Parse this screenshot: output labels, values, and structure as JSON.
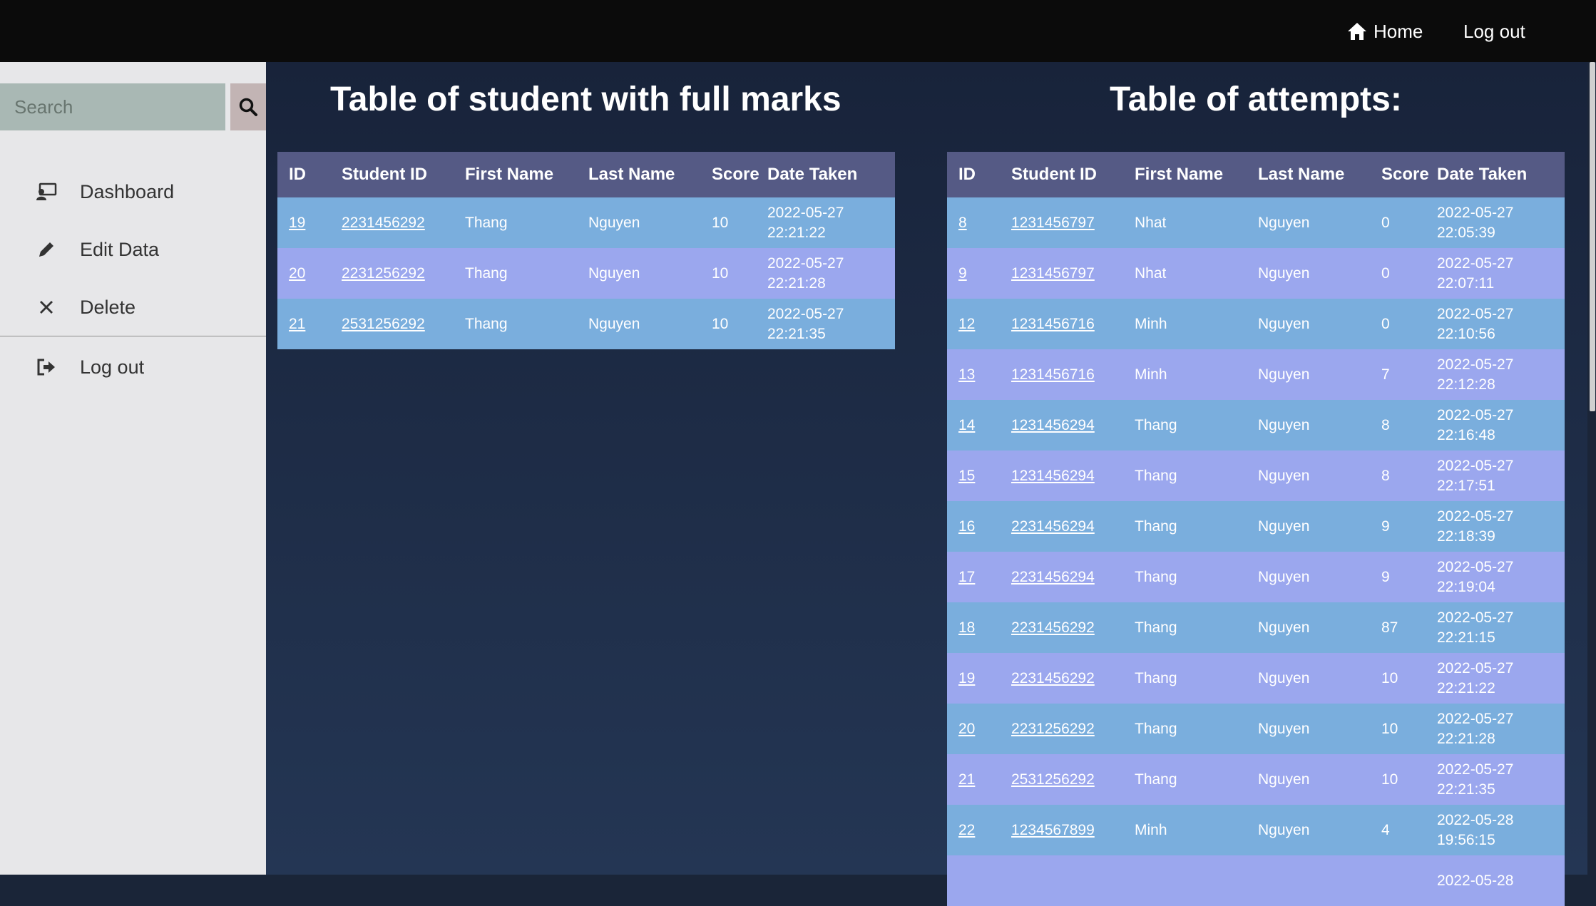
{
  "topbar": {
    "home_label": "Home",
    "logout_label": "Log out"
  },
  "sidebar": {
    "search_placeholder": "Search",
    "items": [
      {
        "label": "Dashboard",
        "icon": "dashboard-icon"
      },
      {
        "label": "Edit Data",
        "icon": "pencil-icon"
      },
      {
        "label": "Delete",
        "icon": "close-icon"
      },
      {
        "label": "Log out",
        "icon": "logout-icon"
      }
    ]
  },
  "columns": [
    "ID",
    "Student ID",
    "First Name",
    "Last Name",
    "Score",
    "Date Taken"
  ],
  "full_marks": {
    "title": "Table of student with full marks",
    "rows": [
      {
        "id": "19",
        "student_id": "2231456292",
        "first": "Thang",
        "last": "Nguyen",
        "score": "10",
        "date": "2022-05-27",
        "time": "22:21:22"
      },
      {
        "id": "20",
        "student_id": "2231256292",
        "first": "Thang",
        "last": "Nguyen",
        "score": "10",
        "date": "2022-05-27",
        "time": "22:21:28"
      },
      {
        "id": "21",
        "student_id": "2531256292",
        "first": "Thang",
        "last": "Nguyen",
        "score": "10",
        "date": "2022-05-27",
        "time": "22:21:35"
      }
    ]
  },
  "attempts": {
    "title": "Table of attempts:",
    "rows": [
      {
        "id": "8",
        "student_id": "1231456797",
        "first": "Nhat",
        "last": "Nguyen",
        "score": "0",
        "date": "2022-05-27",
        "time": "22:05:39"
      },
      {
        "id": "9",
        "student_id": "1231456797",
        "first": "Nhat",
        "last": "Nguyen",
        "score": "0",
        "date": "2022-05-27",
        "time": "22:07:11"
      },
      {
        "id": "12",
        "student_id": "1231456716",
        "first": "Minh",
        "last": "Nguyen",
        "score": "0",
        "date": "2022-05-27",
        "time": "22:10:56"
      },
      {
        "id": "13",
        "student_id": "1231456716",
        "first": "Minh",
        "last": "Nguyen",
        "score": "7",
        "date": "2022-05-27",
        "time": "22:12:28"
      },
      {
        "id": "14",
        "student_id": "1231456294",
        "first": "Thang",
        "last": "Nguyen",
        "score": "8",
        "date": "2022-05-27",
        "time": "22:16:48"
      },
      {
        "id": "15",
        "student_id": "1231456294",
        "first": "Thang",
        "last": "Nguyen",
        "score": "8",
        "date": "2022-05-27",
        "time": "22:17:51"
      },
      {
        "id": "16",
        "student_id": "2231456294",
        "first": "Thang",
        "last": "Nguyen",
        "score": "9",
        "date": "2022-05-27",
        "time": "22:18:39"
      },
      {
        "id": "17",
        "student_id": "2231456294",
        "first": "Thang",
        "last": "Nguyen",
        "score": "9",
        "date": "2022-05-27",
        "time": "22:19:04"
      },
      {
        "id": "18",
        "student_id": "2231456292",
        "first": "Thang",
        "last": "Nguyen",
        "score": "87",
        "date": "2022-05-27",
        "time": "22:21:15"
      },
      {
        "id": "19",
        "student_id": "2231456292",
        "first": "Thang",
        "last": "Nguyen",
        "score": "10",
        "date": "2022-05-27",
        "time": "22:21:22"
      },
      {
        "id": "20",
        "student_id": "2231256292",
        "first": "Thang",
        "last": "Nguyen",
        "score": "10",
        "date": "2022-05-27",
        "time": "22:21:28"
      },
      {
        "id": "21",
        "student_id": "2531256292",
        "first": "Thang",
        "last": "Nguyen",
        "score": "10",
        "date": "2022-05-27",
        "time": "22:21:35"
      },
      {
        "id": "22",
        "student_id": "1234567899",
        "first": "Minh",
        "last": "Nguyen",
        "score": "4",
        "date": "2022-05-28",
        "time": "19:56:15"
      },
      {
        "id": "",
        "student_id": "",
        "first": "",
        "last": "",
        "score": "",
        "date": "2022-05-28",
        "time": ""
      }
    ]
  }
}
